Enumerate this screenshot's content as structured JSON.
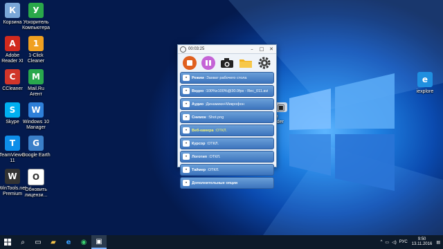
{
  "desktop": {
    "icons_left": [
      {
        "label": "Корзина",
        "icon": "recycle-bin-icon",
        "color": "#7aa7d8"
      },
      {
        "label": "Ускоритель\nКомпьютера",
        "icon": "speedometer-icon",
        "color": "#2aa84a"
      },
      {
        "label": "Adobe\nReader XI",
        "icon": "pdf-icon",
        "color": "#d12a1e"
      },
      {
        "label": "1-Click\nCleaner",
        "icon": "cleaner-icon",
        "color": "#f0a020"
      },
      {
        "label": "CCleaner",
        "icon": "ccleaner-icon",
        "color": "#d0352a"
      },
      {
        "label": "Mail.Ru\nАгент",
        "icon": "mailru-icon",
        "color": "#29a84d"
      },
      {
        "label": "Skype",
        "icon": "skype-icon",
        "color": "#00aff0"
      },
      {
        "label": "Windows 10\nManager",
        "icon": "win10-manager-icon",
        "color": "#2e7fd8"
      },
      {
        "label": "TeamViewer\n11",
        "icon": "teamviewer-icon",
        "color": "#0e8ee9"
      },
      {
        "label": "Google Earth",
        "icon": "globe-icon",
        "color": "#3a7fc8"
      },
      {
        "label": "WinTools.net\nPremium",
        "icon": "wintools-icon",
        "color": "#333333"
      },
      {
        "label": "Обновить\nлицензи...",
        "icon": "shield-icon",
        "color": "#ffffff"
      }
    ],
    "icon_right": {
      "label": "iexplore",
      "icon": "ie-icon",
      "color": "#1f8fe0"
    },
    "partial_label": "een\ncorder"
  },
  "app": {
    "time": "00:03:25",
    "controls": {
      "minimize": "–",
      "maximize": "□",
      "close": "✕"
    },
    "toolbar": [
      {
        "name": "stop-button",
        "icon": "stop-icon",
        "color": "#e06020"
      },
      {
        "name": "pause-button",
        "icon": "pause-icon",
        "color": "#c060d0"
      },
      {
        "name": "screenshot-button",
        "icon": "camera-icon",
        "color": "#333333"
      },
      {
        "name": "folder-button",
        "icon": "folder-icon",
        "color": "#f0b020"
      },
      {
        "name": "settings-button",
        "icon": "gear-icon",
        "color": "#444444"
      }
    ],
    "rows": [
      {
        "key": "Режим",
        "value": "Захват рабочего стола",
        "icon": "monitor-icon",
        "color": null
      },
      {
        "key": "Видео",
        "value": "100%x100%@30.0fps - Rec_011.avi",
        "icon": "film-icon",
        "color": null
      },
      {
        "key": "Аудио",
        "value": "Динамики+Микрофон",
        "icon": "audio-icon",
        "color": null
      },
      {
        "key": "Снимок",
        "value": "Shot.png",
        "icon": "camera-icon",
        "color": null
      },
      {
        "key": "Веб-камера",
        "value": "ОТКЛ.",
        "icon": "webcam-icon",
        "color": "#f3f170"
      },
      {
        "key": "Курсор",
        "value": "ОТКЛ.",
        "icon": "cursor-icon",
        "color": null
      },
      {
        "key": "Логотип",
        "value": "ОТКЛ.",
        "icon": "logo-icon",
        "color": null
      },
      {
        "key": "Таймер",
        "value": "ОТКЛ.",
        "icon": "timer-icon",
        "color": null
      },
      {
        "key": "Дополнительные опции",
        "value": "",
        "icon": "tools-icon",
        "color": null
      }
    ]
  },
  "taskbar": {
    "lang": "РУС",
    "time": "9:50",
    "date": "13.11.2016"
  }
}
